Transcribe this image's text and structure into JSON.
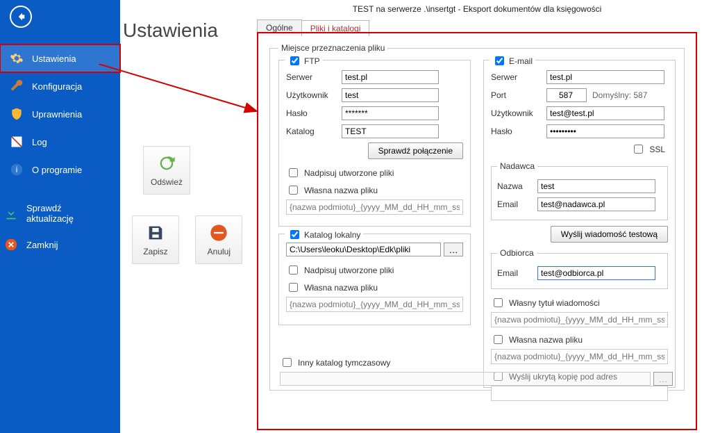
{
  "window_title": "TEST na serwerze .\\insertgt - Eksport dokumentów dla księgowości",
  "settings_heading": "Ustawienia",
  "nav": {
    "ustawienia": "Ustawienia",
    "konfiguracja": "Konfiguracja",
    "uprawnienia": "Uprawnienia",
    "log": "Log",
    "oprogramie": "O programie",
    "aktualizacje": "Sprawdź aktualizację",
    "zamknij": "Zamknij"
  },
  "center": {
    "refresh": "Odśwież",
    "save": "Zapisz",
    "cancel": "Anuluj"
  },
  "tabs": {
    "general": "Ogólne",
    "files": "Pliki i katalogi"
  },
  "dest": {
    "legend": "Miejsce przeznaczenia pliku",
    "ftp": {
      "label": "FTP",
      "server_lbl": "Serwer",
      "server": "test.pl",
      "user_lbl": "Użytkownik",
      "user": "test",
      "pass_lbl": "Hasło",
      "pass": "*******",
      "dir_lbl": "Katalog",
      "dir": "TEST",
      "check_btn": "Sprawdź połączenie",
      "overwrite": "Nadpisuj utworzone pliki",
      "ownname": "Własna nazwa pliku",
      "ownname_ph": "{nazwa podmiotu}_{yyyy_MM_dd_HH_mm_ss}"
    },
    "local": {
      "label": "Katalog lokalny",
      "path": "C:\\Users\\leoku\\Desktop\\Edk\\pliki",
      "overwrite": "Nadpisuj utworzone pliki",
      "ownname": "Własna nazwa pliku",
      "ownname_ph": "{nazwa podmiotu}_{yyyy_MM_dd_HH_mm_ss}"
    },
    "email": {
      "label": "E-mail",
      "server_lbl": "Serwer",
      "server": "test.pl",
      "port_lbl": "Port",
      "port": "587",
      "port_hint": "Domyślny: 587",
      "user_lbl": "Użytkownik",
      "user": "test@test.pl",
      "pass_lbl": "Hasło",
      "pass": "•••••••••",
      "ssl": "SSL",
      "sender_legend": "Nadawca",
      "sender_name_lbl": "Nazwa",
      "sender_name": "test",
      "sender_email_lbl": "Email",
      "sender_email": "test@nadawca.pl",
      "test_btn": "Wyślij wiadomość testową",
      "recipient_legend": "Odbiorca",
      "recipient_email_lbl": "Email",
      "recipient_email": "test@odbiorca.pl",
      "own_subject": "Własny tytuł wiadomości",
      "own_subject_ph": "{nazwa podmiotu}_{yyyy_MM_dd_HH_mm_ss}",
      "own_name": "Własna nazwa pliku",
      "own_name_ph": "{nazwa podmiotu}_{yyyy_MM_dd_HH_mm_ss}",
      "bcc": "Wyślij ukrytą kopię pod adres"
    },
    "tmp": {
      "label": "Inny katalog tymczasowy"
    }
  }
}
